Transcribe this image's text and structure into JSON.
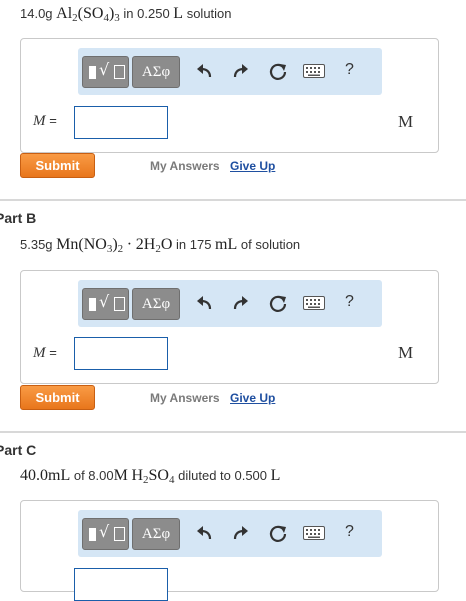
{
  "part_a": {
    "problem": {
      "mass": "14.0g",
      "formula_al": "Al",
      "sub2": "2",
      "formula_so": "(SO",
      "sub4": "4",
      "close": ")",
      "sub3": "3",
      "in_text": "in 0.250",
      "unit_l": "L",
      "tail": "solution"
    },
    "answer_label": "M",
    "equals": "=",
    "unit": "M",
    "submit": "Submit",
    "my_answers": "My Answers",
    "give_up": "Give Up"
  },
  "part_b": {
    "heading": "Part B",
    "problem": {
      "mass": "5.35g",
      "f1": "Mn(NO",
      "sub3": "3",
      "f2": ")",
      "sub2": "2",
      "dot": "·",
      "f3": "2H",
      "sub2b": "2",
      "f4": "O",
      "in_text": "in 175",
      "unit_ml": "mL",
      "tail": "of solution"
    },
    "answer_label": "M",
    "equals": "=",
    "unit": "M",
    "submit": "Submit",
    "my_answers": "My Answers",
    "give_up": "Give Up"
  },
  "part_c": {
    "heading": "Part C",
    "problem": {
      "vol": "40.0",
      "unit_ml": "mL",
      "of_text": "of 8.00",
      "m": "M",
      "h": "H",
      "sub2": "2",
      "so": "SO",
      "sub4": "4",
      "diluted": "diluted to 0.500",
      "unit_l": "L"
    }
  },
  "toolbar": {
    "greek": "ΑΣφ",
    "help": "?",
    "icons": [
      "templates-icon",
      "undo-icon",
      "redo-icon",
      "reset-icon",
      "keyboard-icon",
      "help-icon"
    ]
  },
  "colors": {
    "submit": "#e8761c",
    "toolbar_bg": "#d5e6f5",
    "link": "#1f4fa0",
    "input_border": "#1a5eaa"
  }
}
